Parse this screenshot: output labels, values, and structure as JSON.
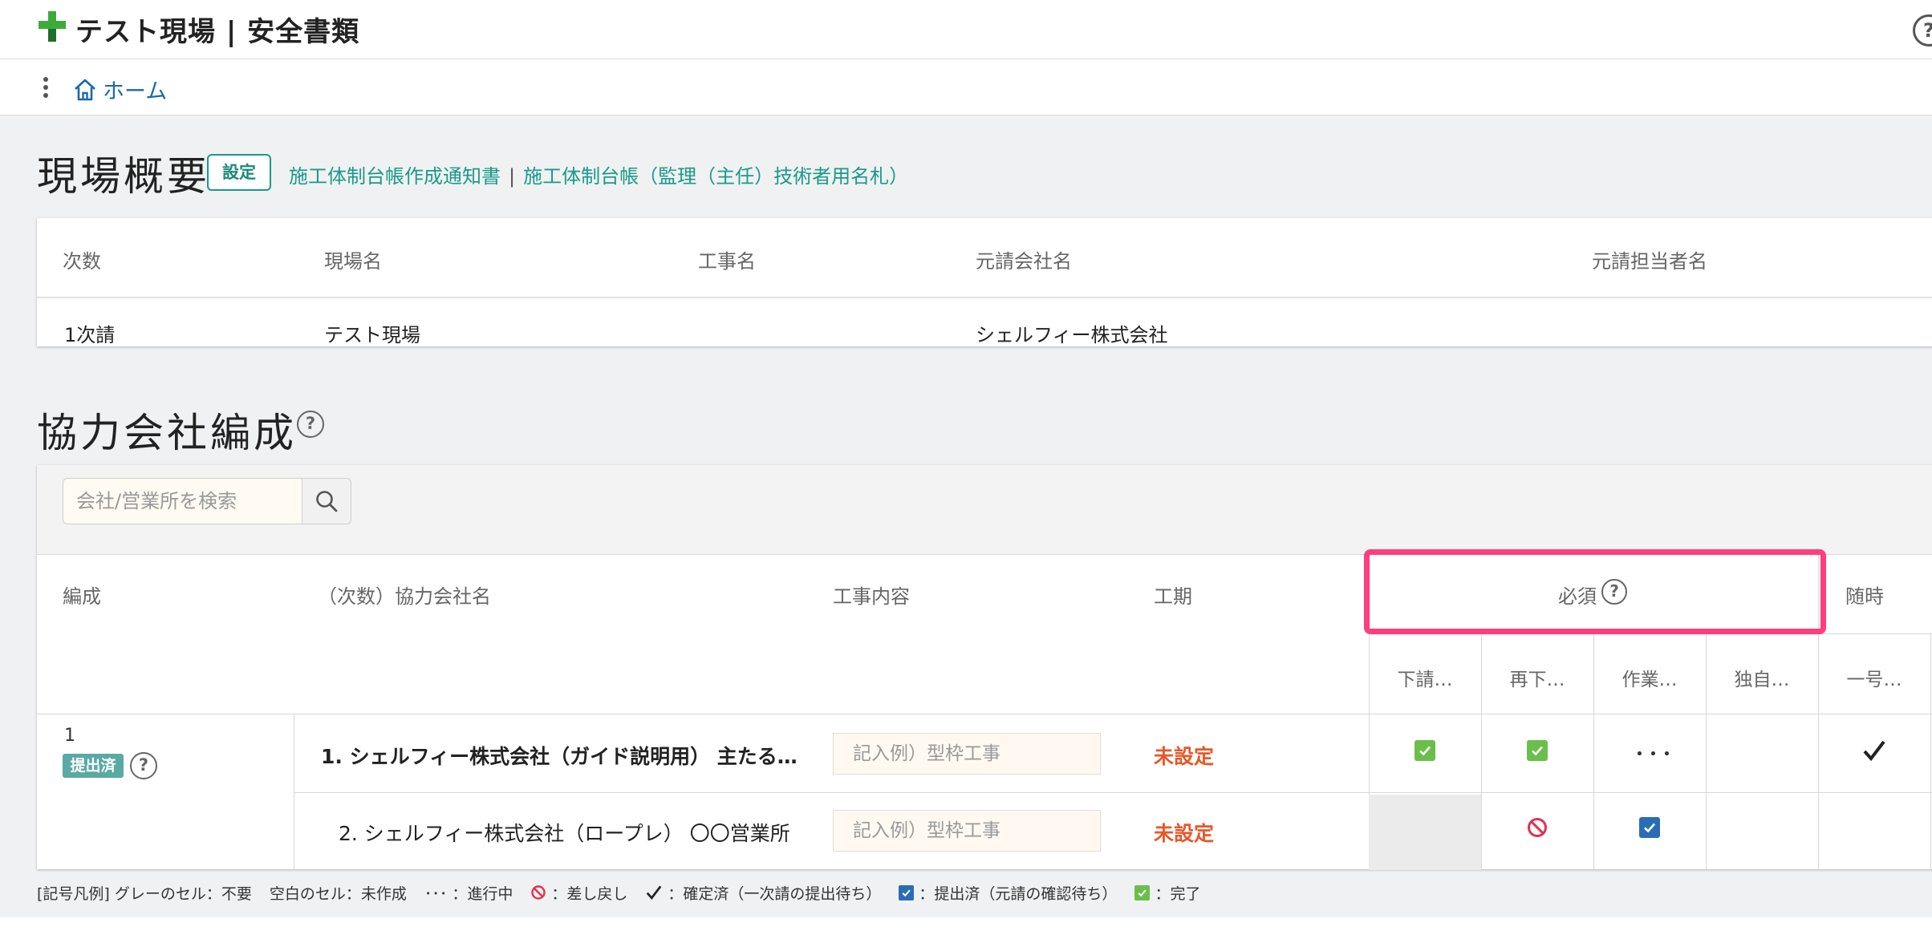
{
  "header": {
    "title": "テスト現場 | 安全書類",
    "help": "?"
  },
  "breadcrumb": {
    "home": "ホーム"
  },
  "overview": {
    "title": "現場概要",
    "settings_label": "設定",
    "link1": "施工体制台帳作成通知書",
    "link_sep": "|",
    "link2": "施工体制台帳（監理（主任）技術者用名札）",
    "columns": [
      "次数",
      "現場名",
      "工事名",
      "元請会社名",
      "元請担当者名"
    ],
    "row": [
      "1次請",
      "テスト現場",
      "",
      "シェルフィー株式会社",
      ""
    ]
  },
  "partners": {
    "title": "協力会社編成",
    "help": "?",
    "search_placeholder": "会社/営業所を検索",
    "columns": {
      "formation": "編成",
      "company": "（次数）協力会社名",
      "work": "工事内容",
      "period": "工期",
      "required": "必須",
      "optional": "随時"
    },
    "sub_columns": [
      "下請…",
      "再下…",
      "作業…",
      "独自…",
      "一号…"
    ],
    "group": {
      "number": "1",
      "status": "提出済"
    },
    "rows": [
      {
        "company": "1. シェルフィー株式会社（ガイド説明用） 主たる…",
        "work_placeholder": "記入例）型枠工事",
        "period": "未設定"
      },
      {
        "company": "2. シェルフィー株式会社（ロープレ） 〇〇営業所",
        "work_placeholder": "記入例）型枠工事",
        "period": "未設定"
      }
    ]
  },
  "legend": {
    "title": "[記号凡例]",
    "grey": "グレーのセル：不要",
    "blank": "空白のセル：未作成",
    "dots": "･･･",
    "in_progress": "：進行中",
    "returned": "：差し戻し",
    "confirmed": "：確定済（一次請の提出待ち）",
    "submitted": "：提出済（元請の確認待ち）",
    "done": "：完了"
  },
  "colors": {
    "accent": "#1a9a8a",
    "highlight": "#ff3d7f",
    "unset": "#e8572a",
    "done": "#6abf4b",
    "submitted": "#2a6db5",
    "returned": "#e0334f"
  },
  "icons": {
    "logo": "green-cross-icon",
    "home": "home-icon",
    "search": "search-icon",
    "returned": "prohibited-icon",
    "confirmed": "checkmark-icon"
  }
}
